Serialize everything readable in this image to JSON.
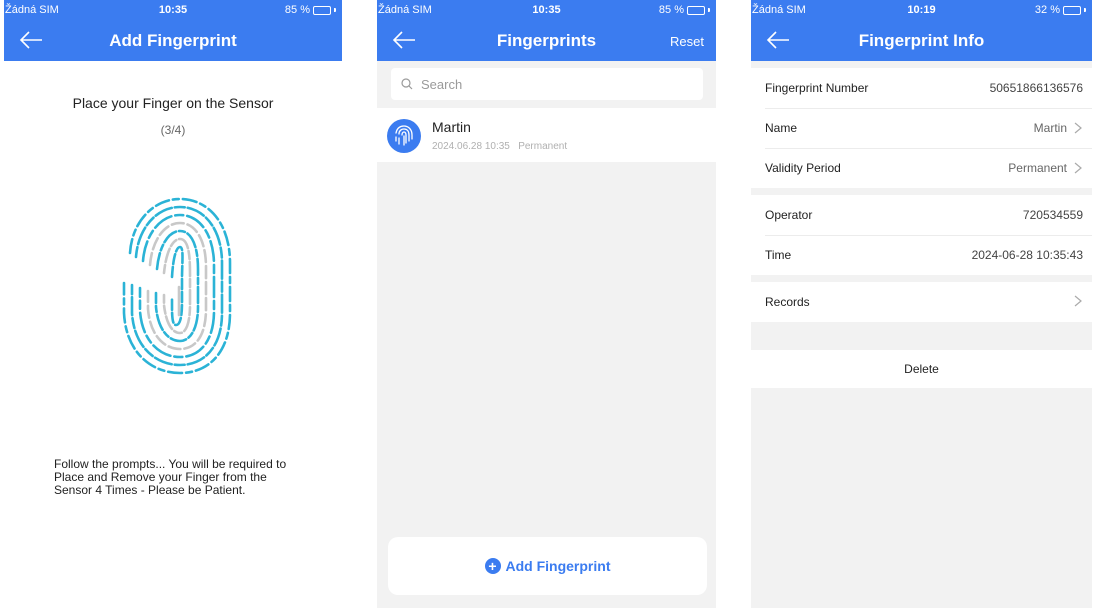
{
  "screens": [
    {
      "status": {
        "carrier": "Žádná SIM",
        "time": "10:35",
        "battery": "85 %",
        "battery_level": 0.85
      },
      "nav": {
        "title": "Add Fingerprint"
      },
      "prompt_title": "Place your Finger on the Sensor",
      "prompt_step": "(3/4)",
      "prompt_text": "Follow the prompts... You will be required to Place and Remove your Finger from the Sensor 4 Times - Please be Patient."
    },
    {
      "status": {
        "carrier": "Žádná SIM",
        "time": "10:35",
        "battery": "85 %",
        "battery_level": 0.85
      },
      "nav": {
        "title": "Fingerprints",
        "action": "Reset"
      },
      "search": {
        "placeholder": "Search"
      },
      "items": [
        {
          "name": "Martin",
          "date": "2024.06.28 10:35",
          "validity": "Permanent"
        }
      ],
      "add_button": "Add Fingerprint"
    },
    {
      "status": {
        "carrier": "Žádná SIM",
        "time": "10:19",
        "battery": "32 %",
        "battery_level": 0.32
      },
      "nav": {
        "title": "Fingerprint Info"
      },
      "rows": [
        {
          "label": "Fingerprint Number",
          "value": "50651866136576"
        },
        {
          "label": "Name",
          "value": "Martin"
        },
        {
          "label": "Validity Period",
          "value": "Permanent"
        },
        {
          "label": "Operator",
          "value": "720534559"
        },
        {
          "label": "Time",
          "value": "2024-06-28 10:35:43"
        },
        {
          "label": "Records",
          "value": ""
        }
      ],
      "delete_label": "Delete"
    }
  ],
  "colors": {
    "accent": "#3b7cf0",
    "fingerprint_teal": "#2bb3d6",
    "fingerprint_grey": "#c8c8c8",
    "background": "#f2f2f2"
  }
}
